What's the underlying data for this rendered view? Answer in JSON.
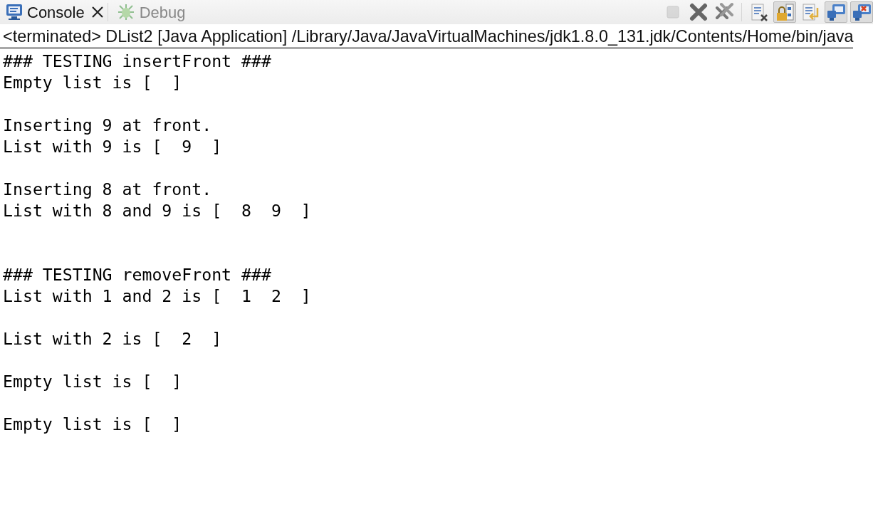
{
  "tabs": [
    {
      "label": "Console",
      "selected": true,
      "closable": true,
      "kind": "console"
    },
    {
      "label": "Debug",
      "selected": false,
      "closable": false,
      "kind": "debug"
    }
  ],
  "toolbar": [
    {
      "kind": "terminate",
      "disabled": true,
      "pressed": false
    },
    {
      "kind": "remove",
      "disabled": false,
      "pressed": false
    },
    {
      "kind": "remove-all",
      "disabled": false,
      "pressed": false
    },
    {
      "kind": "clear",
      "disabled": false,
      "pressed": false
    },
    {
      "kind": "scroll-lock",
      "disabled": false,
      "pressed": true
    },
    {
      "kind": "word-wrap",
      "disabled": false,
      "pressed": false
    },
    {
      "kind": "pin",
      "disabled": false,
      "pressed": true
    },
    {
      "kind": "display",
      "disabled": false,
      "pressed": true
    }
  ],
  "process_label": "<terminated> DList2 [Java Application] /Library/Java/JavaVirtualMachines/jdk1.8.0_131.jdk/Contents/Home/bin/java",
  "output": [
    {
      "blocks": [
        [
          "### TESTING insertFront ###",
          "Empty list is [  ]"
        ],
        [
          "Inserting 9 at front.",
          "List with 9 is [  9  ]"
        ],
        [
          "Inserting 8 at front.",
          "List with 8 and 9 is [  8  9  ]"
        ]
      ]
    },
    {
      "blocks": [
        [
          "### TESTING removeFront ###",
          "List with 1 and 2 is [  1  2  ]"
        ],
        [
          "List with 2 is [  2  ]"
        ],
        [
          "Empty list is [  ]"
        ],
        [
          "Empty list is [  ]"
        ]
      ]
    }
  ]
}
